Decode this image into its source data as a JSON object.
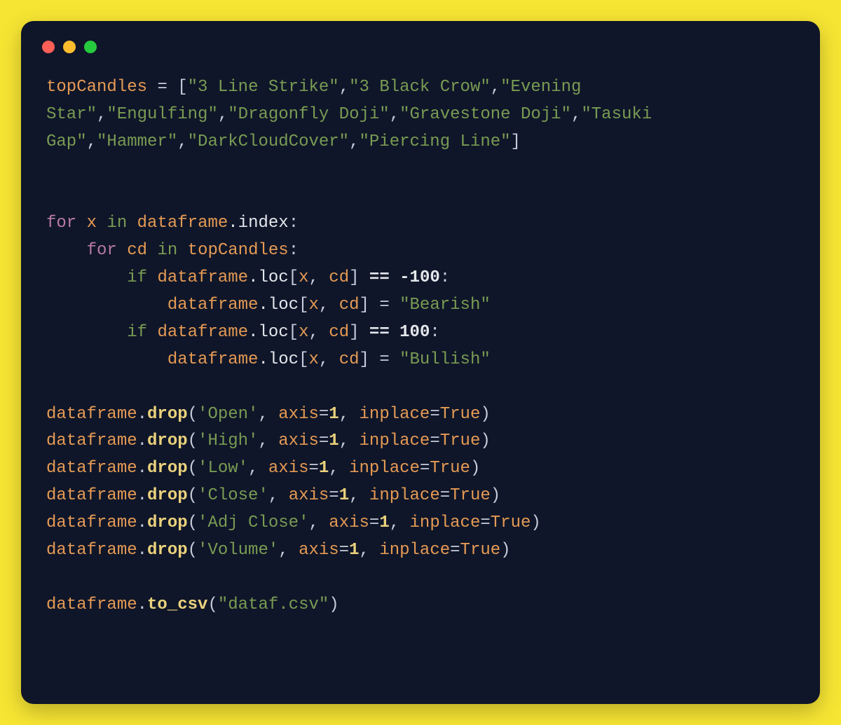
{
  "colors": {
    "page_bg": "#f7e533",
    "window_bg": "#0f1629",
    "dot_close": "#ff5f56",
    "dot_min": "#ffbd2e",
    "dot_zoom": "#27c93f"
  },
  "code": {
    "topCandles_var": "topCandles",
    "topCandles_items": [
      "3 Line Strike",
      "3 Black Crow",
      "Evening Star",
      "Engulfing",
      "Dragonfly Doji",
      "Gravestone Doji",
      "Tasuki Gap",
      "Hammer",
      "DarkCloudCover",
      "Piercing Line"
    ],
    "outer_for_kw": "for",
    "outer_var": "x",
    "in_kw": "in",
    "df": "dataframe",
    "index_attr": ".index",
    "colon": ":",
    "inner_for_kw": "for",
    "inner_var": "cd",
    "topCandles_ref": "topCandles",
    "if_kw_1": "if",
    "loc_attr": ".loc",
    "bracket_open": "[",
    "bracket_close": "]",
    "x_ref": "x",
    "cd_ref": "cd",
    "eq_test": "==",
    "neg100": "-100",
    "assign": "=",
    "bearish_str": "\"Bearish\"",
    "if_kw_2": "if",
    "pos100": "100",
    "bullish_str": "\"Bullish\"",
    "drop_fn": "drop",
    "drop_cols": [
      "'Open'",
      "'High'",
      "'Low'",
      "'Close'",
      "'Adj Close'",
      "'Volume'"
    ],
    "axis_kw": "axis",
    "axis_val": "1",
    "inplace_kw": "inplace",
    "true_kw": "True",
    "to_csv_fn": "to_csv",
    "csv_arg": "\"dataf.csv\""
  }
}
